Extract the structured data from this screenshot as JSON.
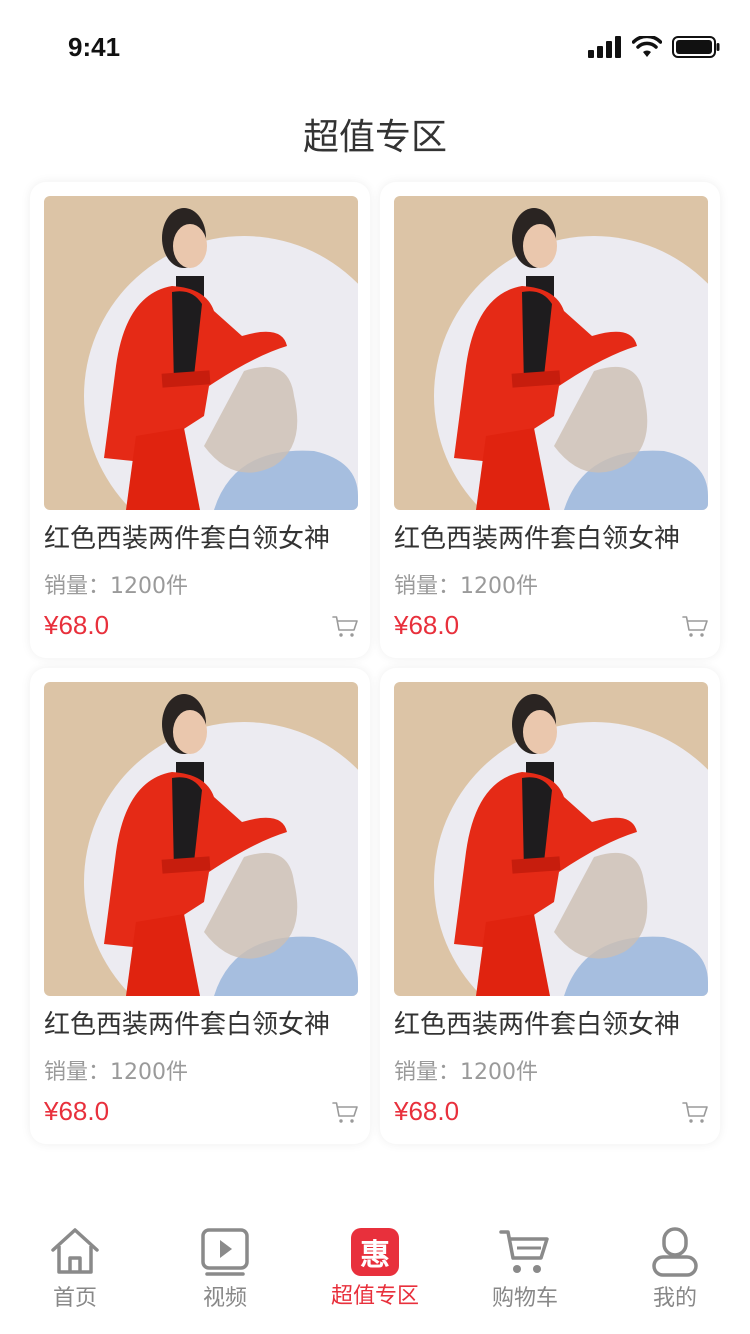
{
  "status_bar": {
    "time": "9:41"
  },
  "page": {
    "title": "超值专区"
  },
  "products": [
    {
      "title": "红色西装两件套白领女神",
      "sales": "销量：1200件",
      "price": "¥68.0"
    },
    {
      "title": "红色西装两件套白领女神",
      "sales": "销量：1200件",
      "price": "¥68.0"
    },
    {
      "title": "红色西装两件套白领女神",
      "sales": "销量：1200件",
      "price": "¥68.0"
    },
    {
      "title": "红色西装两件套白领女神",
      "sales": "销量：1200件",
      "price": "¥68.0"
    }
  ],
  "tabbar": {
    "items": [
      {
        "label": "首页",
        "icon": "home-icon"
      },
      {
        "label": "视频",
        "icon": "video-icon"
      },
      {
        "label": "超值专区",
        "icon": "deal-icon",
        "badge": "惠",
        "active": true
      },
      {
        "label": "购物车",
        "icon": "cart-icon"
      },
      {
        "label": "我的",
        "icon": "user-icon"
      }
    ]
  },
  "colors": {
    "accent": "#e8303c",
    "muted_text": "#9a9a9a",
    "icon_gray": "#8a8a8a"
  }
}
